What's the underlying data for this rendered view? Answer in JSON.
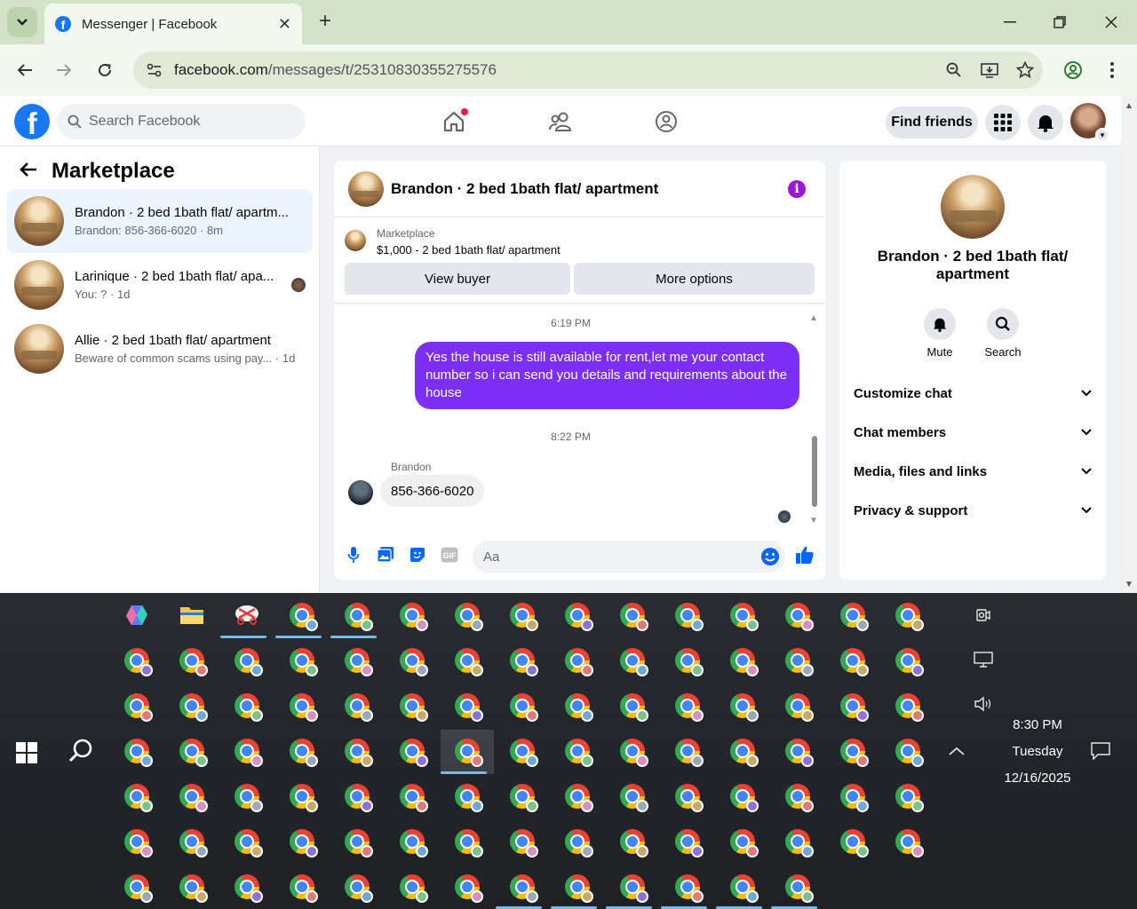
{
  "browser": {
    "tab_title": "Messenger | Facebook",
    "url_host": "facebook.com",
    "url_path": "/messages/t/25310830355275576"
  },
  "fb": {
    "search_placeholder": "Search Facebook",
    "find_friends": "Find friends"
  },
  "sidebar": {
    "title": "Marketplace",
    "conversations": [
      {
        "name": "Brandon · 2 bed 1bath flat/ apartm...",
        "sub": "Brandon: 856-366-6020 · 8m"
      },
      {
        "name": "Larinique · 2 bed 1bath flat/ apa...",
        "sub": "You: ? · 1d"
      },
      {
        "name": "Allie · 2 bed 1bath flat/ apartment",
        "sub": "Beware of common scams using pay...  · 1d"
      }
    ]
  },
  "chat": {
    "title": "Brandon · 2 bed 1bath flat/ apartment",
    "marketplace_label": "Marketplace",
    "listing": "$1,000 - 2 bed 1bath flat/ apartment",
    "view_buyer": "View buyer",
    "more_options": "More options",
    "time1": "6:19 PM",
    "outgoing": "Yes the house is still available for rent,let me your contact number so i can send you details and requirements about the house",
    "time2": "8:22 PM",
    "sender": "Brandon",
    "incoming": "856-366-6020",
    "composer_placeholder": "Aa"
  },
  "info": {
    "name": "Brandon · 2 bed 1bath flat/ apartment",
    "mute": "Mute",
    "search": "Search",
    "sections": [
      "Customize chat",
      "Chat members",
      "Media, files and links",
      "Privacy & support"
    ]
  },
  "clock": {
    "time": "8:30 PM",
    "day": "Tuesday",
    "date": "12/16/2025"
  },
  "colors": {
    "fb_blue": "#1877f2",
    "messenger_purple": "#7b2ff7",
    "chrome_frame": "#d3e3c7"
  }
}
